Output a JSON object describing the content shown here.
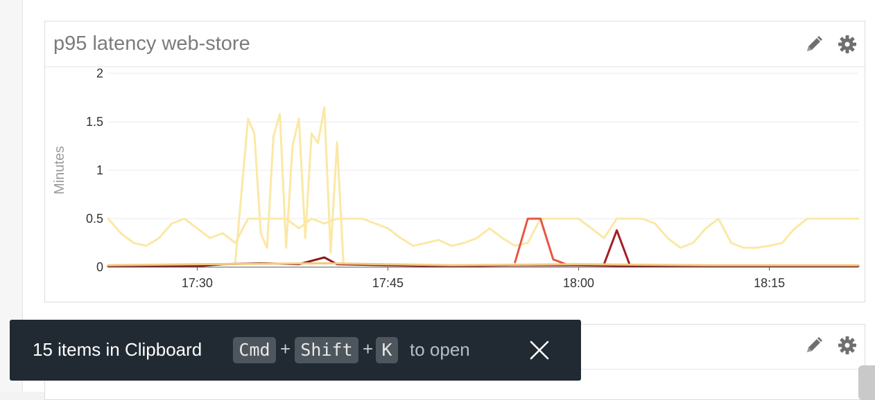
{
  "panels": [
    {
      "title": "p95 latency web-store",
      "edit_icon": "pencil-icon",
      "settings_icon": "gear-icon"
    },
    {
      "title": "",
      "edit_icon": "pencil-icon",
      "settings_icon": "gear-icon"
    }
  ],
  "chart_data": {
    "type": "line",
    "title": "p95 latency web-store",
    "ylabel": "Minutes",
    "xlabel": "",
    "ylim": [
      0,
      2
    ],
    "yticks": [
      "0",
      "0.5",
      "1",
      "1.5",
      "2"
    ],
    "xlim": [
      "17:23",
      "18:22"
    ],
    "xticks": [
      "17:30",
      "17:45",
      "18:00",
      "18:15"
    ],
    "grid": true,
    "series": [
      {
        "color": "#fbe8a6",
        "points": [
          [
            "17:23",
            0.5
          ],
          [
            "17:24",
            0.35
          ],
          [
            "17:25",
            0.25
          ],
          [
            "17:26",
            0.22
          ],
          [
            "17:27",
            0.3
          ],
          [
            "17:28",
            0.45
          ],
          [
            "17:29",
            0.5
          ],
          [
            "17:30",
            0.4
          ],
          [
            "17:31",
            0.3
          ],
          [
            "17:32",
            0.35
          ],
          [
            "17:33",
            0.25
          ],
          [
            "17:34",
            0.5
          ],
          [
            "17:35",
            0.5
          ],
          [
            "17:36",
            0.5
          ],
          [
            "17:37",
            0.5
          ],
          [
            "17:38",
            0.4
          ],
          [
            "17:39",
            0.5
          ],
          [
            "17:40",
            0.45
          ],
          [
            "17:41",
            0.5
          ],
          [
            "17:42",
            0.5
          ],
          [
            "17:43",
            0.5
          ],
          [
            "17:44",
            0.45
          ],
          [
            "17:45",
            0.4
          ],
          [
            "17:46",
            0.3
          ],
          [
            "17:47",
            0.22
          ],
          [
            "17:48",
            0.25
          ],
          [
            "17:49",
            0.28
          ],
          [
            "17:50",
            0.22
          ],
          [
            "17:51",
            0.25
          ],
          [
            "17:52",
            0.3
          ],
          [
            "17:53",
            0.4
          ],
          [
            "17:54",
            0.3
          ],
          [
            "17:55",
            0.22
          ],
          [
            "17:56",
            0.25
          ],
          [
            "17:57",
            0.5
          ],
          [
            "17:58",
            0.5
          ],
          [
            "17:59",
            0.5
          ],
          [
            "18:00",
            0.5
          ],
          [
            "18:01",
            0.4
          ],
          [
            "18:02",
            0.3
          ],
          [
            "18:03",
            0.5
          ],
          [
            "18:04",
            0.5
          ],
          [
            "18:05",
            0.5
          ],
          [
            "18:06",
            0.45
          ],
          [
            "18:07",
            0.3
          ],
          [
            "18:08",
            0.2
          ],
          [
            "18:09",
            0.25
          ],
          [
            "18:10",
            0.4
          ],
          [
            "18:11",
            0.5
          ],
          [
            "18:12",
            0.25
          ],
          [
            "18:13",
            0.2
          ],
          [
            "18:14",
            0.2
          ],
          [
            "18:15",
            0.22
          ],
          [
            "18:16",
            0.25
          ],
          [
            "18:17",
            0.4
          ],
          [
            "18:18",
            0.5
          ],
          [
            "18:19",
            0.5
          ],
          [
            "18:20",
            0.5
          ],
          [
            "18:21",
            0.5
          ],
          [
            "18:22",
            0.5
          ]
        ]
      },
      {
        "color": "#fbe8a6",
        "points": [
          [
            "17:33",
            0.05
          ],
          [
            "17:34",
            1.53
          ],
          [
            "17:34.5",
            1.38
          ],
          [
            "17:35",
            0.35
          ],
          [
            "17:35.5",
            0.2
          ],
          [
            "17:36",
            1.35
          ],
          [
            "17:36.5",
            1.58
          ],
          [
            "17:37",
            0.2
          ],
          [
            "17:37.5",
            1.25
          ],
          [
            "17:38",
            1.53
          ],
          [
            "17:38.5",
            0.3
          ],
          [
            "17:39",
            1.38
          ],
          [
            "17:39.5",
            1.28
          ],
          [
            "17:40",
            1.65
          ],
          [
            "17:40.5",
            0.15
          ],
          [
            "17:41",
            1.29
          ],
          [
            "17:41.5",
            0.05
          ]
        ]
      },
      {
        "color": "#8a1a1f",
        "points": [
          [
            "17:23",
            0.01
          ],
          [
            "17:30",
            0.01
          ],
          [
            "17:32",
            0.03
          ],
          [
            "17:35",
            0.04
          ],
          [
            "17:38",
            0.03
          ],
          [
            "17:40",
            0.1
          ],
          [
            "17:41",
            0.03
          ],
          [
            "17:45",
            0.02
          ],
          [
            "17:50",
            0.01
          ],
          [
            "17:55",
            0.02
          ],
          [
            "18:00",
            0.02
          ],
          [
            "18:05",
            0.01
          ],
          [
            "18:22",
            0.01
          ]
        ]
      },
      {
        "color": "#e8553f",
        "points": [
          [
            "17:55",
            0.05
          ],
          [
            "17:56",
            0.5
          ],
          [
            "17:57",
            0.5
          ],
          [
            "17:58",
            0.08
          ],
          [
            "17:59",
            0.03
          ]
        ]
      },
      {
        "color": "#a31e24",
        "points": [
          [
            "18:02",
            0.03
          ],
          [
            "18:03",
            0.38
          ],
          [
            "18:04",
            0.03
          ]
        ]
      },
      {
        "color": "#f3c97c",
        "points": [
          [
            "17:23",
            0.02
          ],
          [
            "17:30",
            0.03
          ],
          [
            "17:40",
            0.04
          ],
          [
            "17:50",
            0.02
          ],
          [
            "18:00",
            0.03
          ],
          [
            "18:10",
            0.02
          ],
          [
            "18:22",
            0.02
          ]
        ]
      }
    ]
  },
  "clipboard_toast": {
    "message": "15 items in Clipboard",
    "keys": [
      "Cmd",
      "Shift",
      "K"
    ],
    "plus": "+",
    "hint": "to open",
    "close_icon": "close-icon"
  }
}
